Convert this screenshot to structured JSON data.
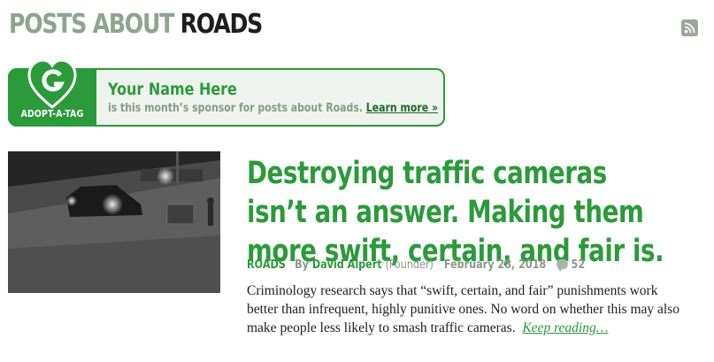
{
  "header": {
    "title_prefix": "POSTS ABOUT",
    "title_tag": "ROADS",
    "feed_icon": "rss-icon"
  },
  "sponsor": {
    "badge_label": "ADOPT-A-TAG",
    "badge_icon": "heart-logo-icon",
    "name": "Your Name Here",
    "text": "is this month’s sponsor for posts about Roads.",
    "link_label": "Learn more »"
  },
  "post": {
    "title": "Destroying traffic cameras isn’t an answer. Making them more swift, certain, and fair is.",
    "tag": "ROADS",
    "by_label": "By",
    "author": "David Alpert",
    "author_role": "(Founder)",
    "date": "February 28, 2018",
    "comment_count": "52",
    "excerpt": "Criminology research says that “swift, certain, and fair” punishments work better than infrequent, highly punitive ones. No word on whether this may also make people less likely to smash traffic cameras.",
    "keep_reading": "Keep reading…"
  },
  "colors": {
    "brand_green": "#2b9a3a",
    "muted_gray": "#8a9a8a"
  }
}
